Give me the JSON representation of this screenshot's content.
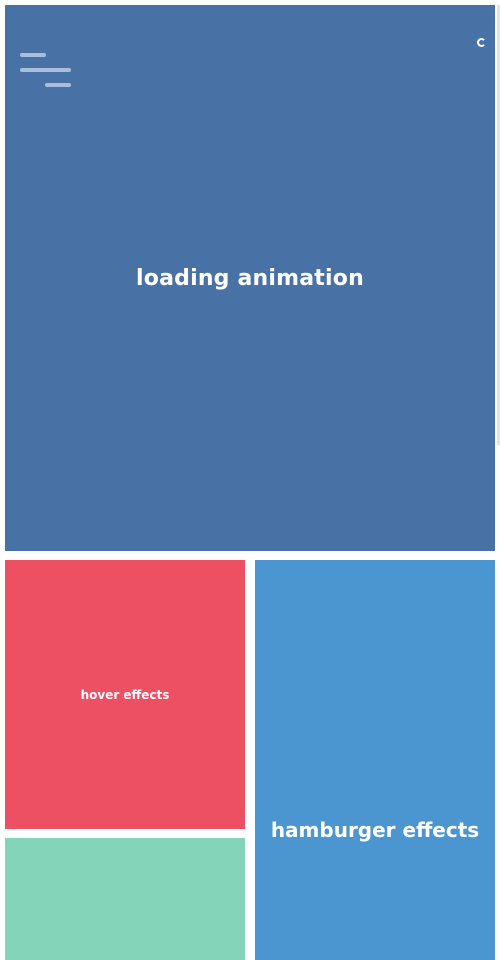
{
  "colors": {
    "hero": "#4872a5",
    "hover": "#ec5062",
    "hamburger": "#4b96d0",
    "teal": "#83d4b9"
  },
  "hero": {
    "title": "loading animation",
    "icons": [
      "hamburger-menu-icon",
      "loading-spinner-icon"
    ]
  },
  "tiles": {
    "hover_title": "hover effects",
    "hamburger_title": "hamburger effects"
  }
}
